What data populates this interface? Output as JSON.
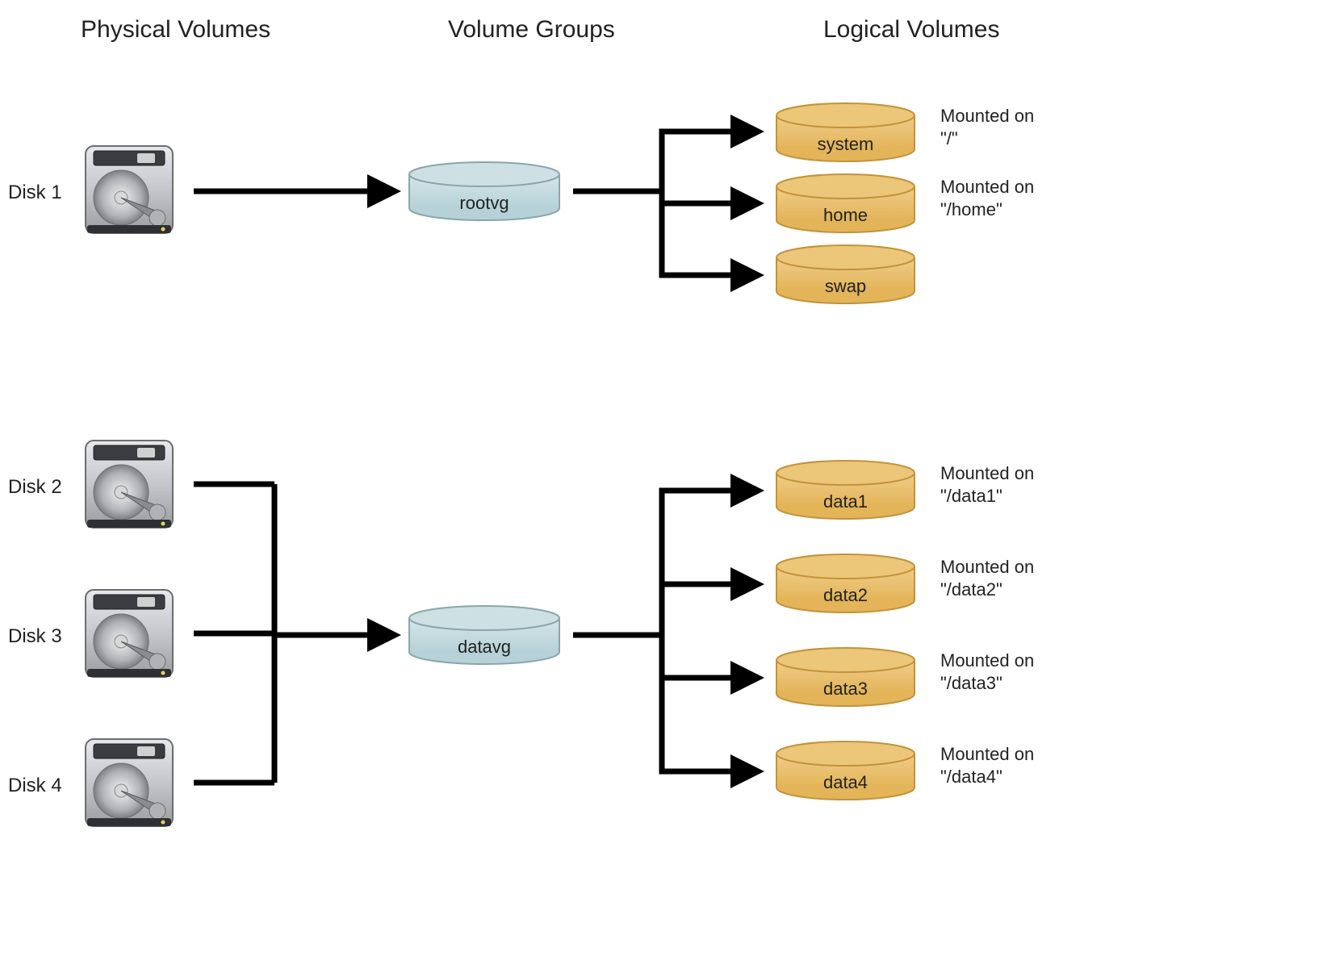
{
  "headers": {
    "physical": "Physical Volumes",
    "groups": "Volume Groups",
    "logical": "Logical Volumes"
  },
  "disks": {
    "d1": "Disk 1",
    "d2": "Disk 2",
    "d3": "Disk 3",
    "d4": "Disk 4"
  },
  "vgroups": {
    "root": "rootvg",
    "data": "datavg"
  },
  "lvols": {
    "system": "system",
    "home": "home",
    "swap": "swap",
    "data1": "data1",
    "data2": "data2",
    "data3": "data3",
    "data4": "data4"
  },
  "mounts": {
    "system": "Mounted on\n\"/\"",
    "home": "Mounted on\n\"/home\"",
    "data1": "Mounted on\n\"/data1\"",
    "data2": "Mounted on\n\"/data2\"",
    "data3": "Mounted on\n\"/data3\"",
    "data4": "Mounted on\n\"/data4\""
  }
}
